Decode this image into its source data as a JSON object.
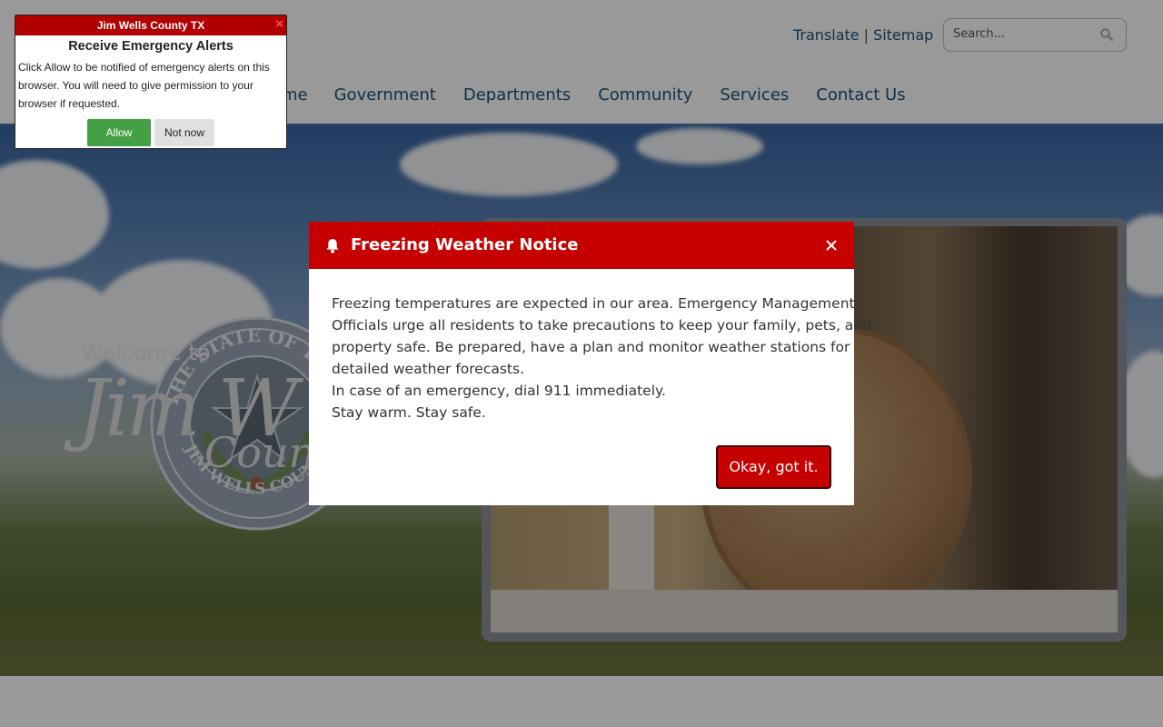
{
  "header": {
    "util_links": {
      "translate": "Translate",
      "separator": "|",
      "sitemap": "Sitemap"
    },
    "search": {
      "placeholder": "Search..."
    },
    "nav": [
      "me",
      "Government",
      "Departments",
      "Community",
      "Services",
      "Contact Us"
    ]
  },
  "hero": {
    "welcome": "Welcome to",
    "script_title": "Jim W",
    "script_sub": "County",
    "seal_top_text": "THE STATE OF TEXAS",
    "seal_bottom_text": "JIM WELLS COUNTY"
  },
  "modal": {
    "title": "Freezing Weather Notice",
    "body_lines": [
      "Freezing temperatures are expected in our area. Emergency Management",
      "Officials urge all residents to take precautions to keep your family, pets, and",
      "property safe. Be prepared, have a plan and monitor weather stations for",
      "detailed weather forecasts.",
      "In case of an emergency, dial 911 immediately.",
      "Stay warm. Stay safe."
    ],
    "ok_label": "Okay, got it."
  },
  "push_prompt": {
    "header": "Jim Wells County TX",
    "close": "×",
    "title": "Receive Emergency Alerts",
    "text_lines": [
      "Click Allow to be notified of emergency alerts on this",
      "browser. You will need to give permission to your",
      "browser if requested."
    ],
    "allow_label": "Allow",
    "notnow_label": "Not now"
  },
  "colors": {
    "brand_red": "#c60000",
    "nav_blue": "#1f4f7a",
    "allow_green": "#44a045"
  },
  "icons": [
    "search-icon",
    "bell-icon",
    "close-icon"
  ]
}
